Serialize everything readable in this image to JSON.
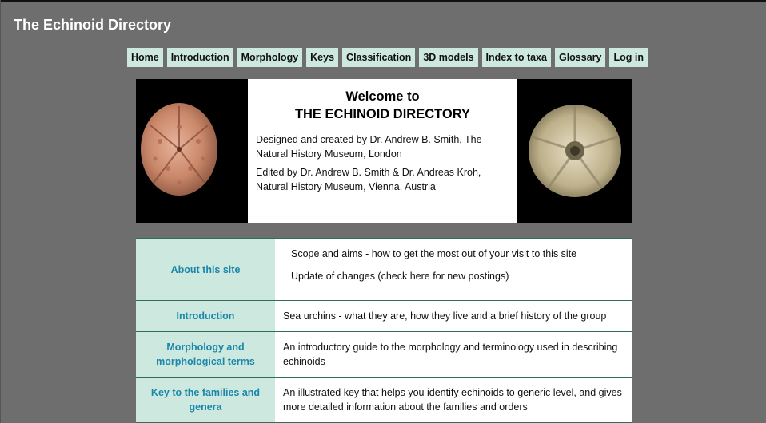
{
  "site": {
    "title": "The Echinoid Directory"
  },
  "nav": [
    {
      "label": "Home"
    },
    {
      "label": "Introduction"
    },
    {
      "label": "Morphology"
    },
    {
      "label": "Keys"
    },
    {
      "label": "Classification"
    },
    {
      "label": "3D models"
    },
    {
      "label": "Index to taxa"
    },
    {
      "label": "Glossary"
    },
    {
      "label": "Log in"
    }
  ],
  "welcome": {
    "line1": "Welcome to",
    "line2": "THE ECHINOID DIRECTORY",
    "designed": "Designed and created by Dr. Andrew B. Smith, The Natural History Museum, London",
    "edited": "Edited by Dr. Andrew B. Smith & Dr. Andreas Kroh, Natural History Museum, Vienna, Austria"
  },
  "sections": [
    {
      "title": "About this site",
      "links": [
        "Scope and aims - how to get the most out of your visit to this site",
        "Update of changes (check here for new postings)"
      ]
    },
    {
      "title": "Introduction",
      "description": "Sea urchins - what they are, how they live and a brief history of the group"
    },
    {
      "title": "Morphology and morphological terms",
      "description": "An introductory guide to the morphology and terminology used in describing echinoids"
    },
    {
      "title": "Key to the families and genera",
      "description": "An illustrated key that helps you identify echinoids to generic level, and gives more detailed information about the families and orders"
    }
  ],
  "colors": {
    "page_background": "#6e6e6e",
    "nav_background": "#cde8df",
    "section_link": "#1a87a8",
    "row_border": "#2f6f5a"
  }
}
